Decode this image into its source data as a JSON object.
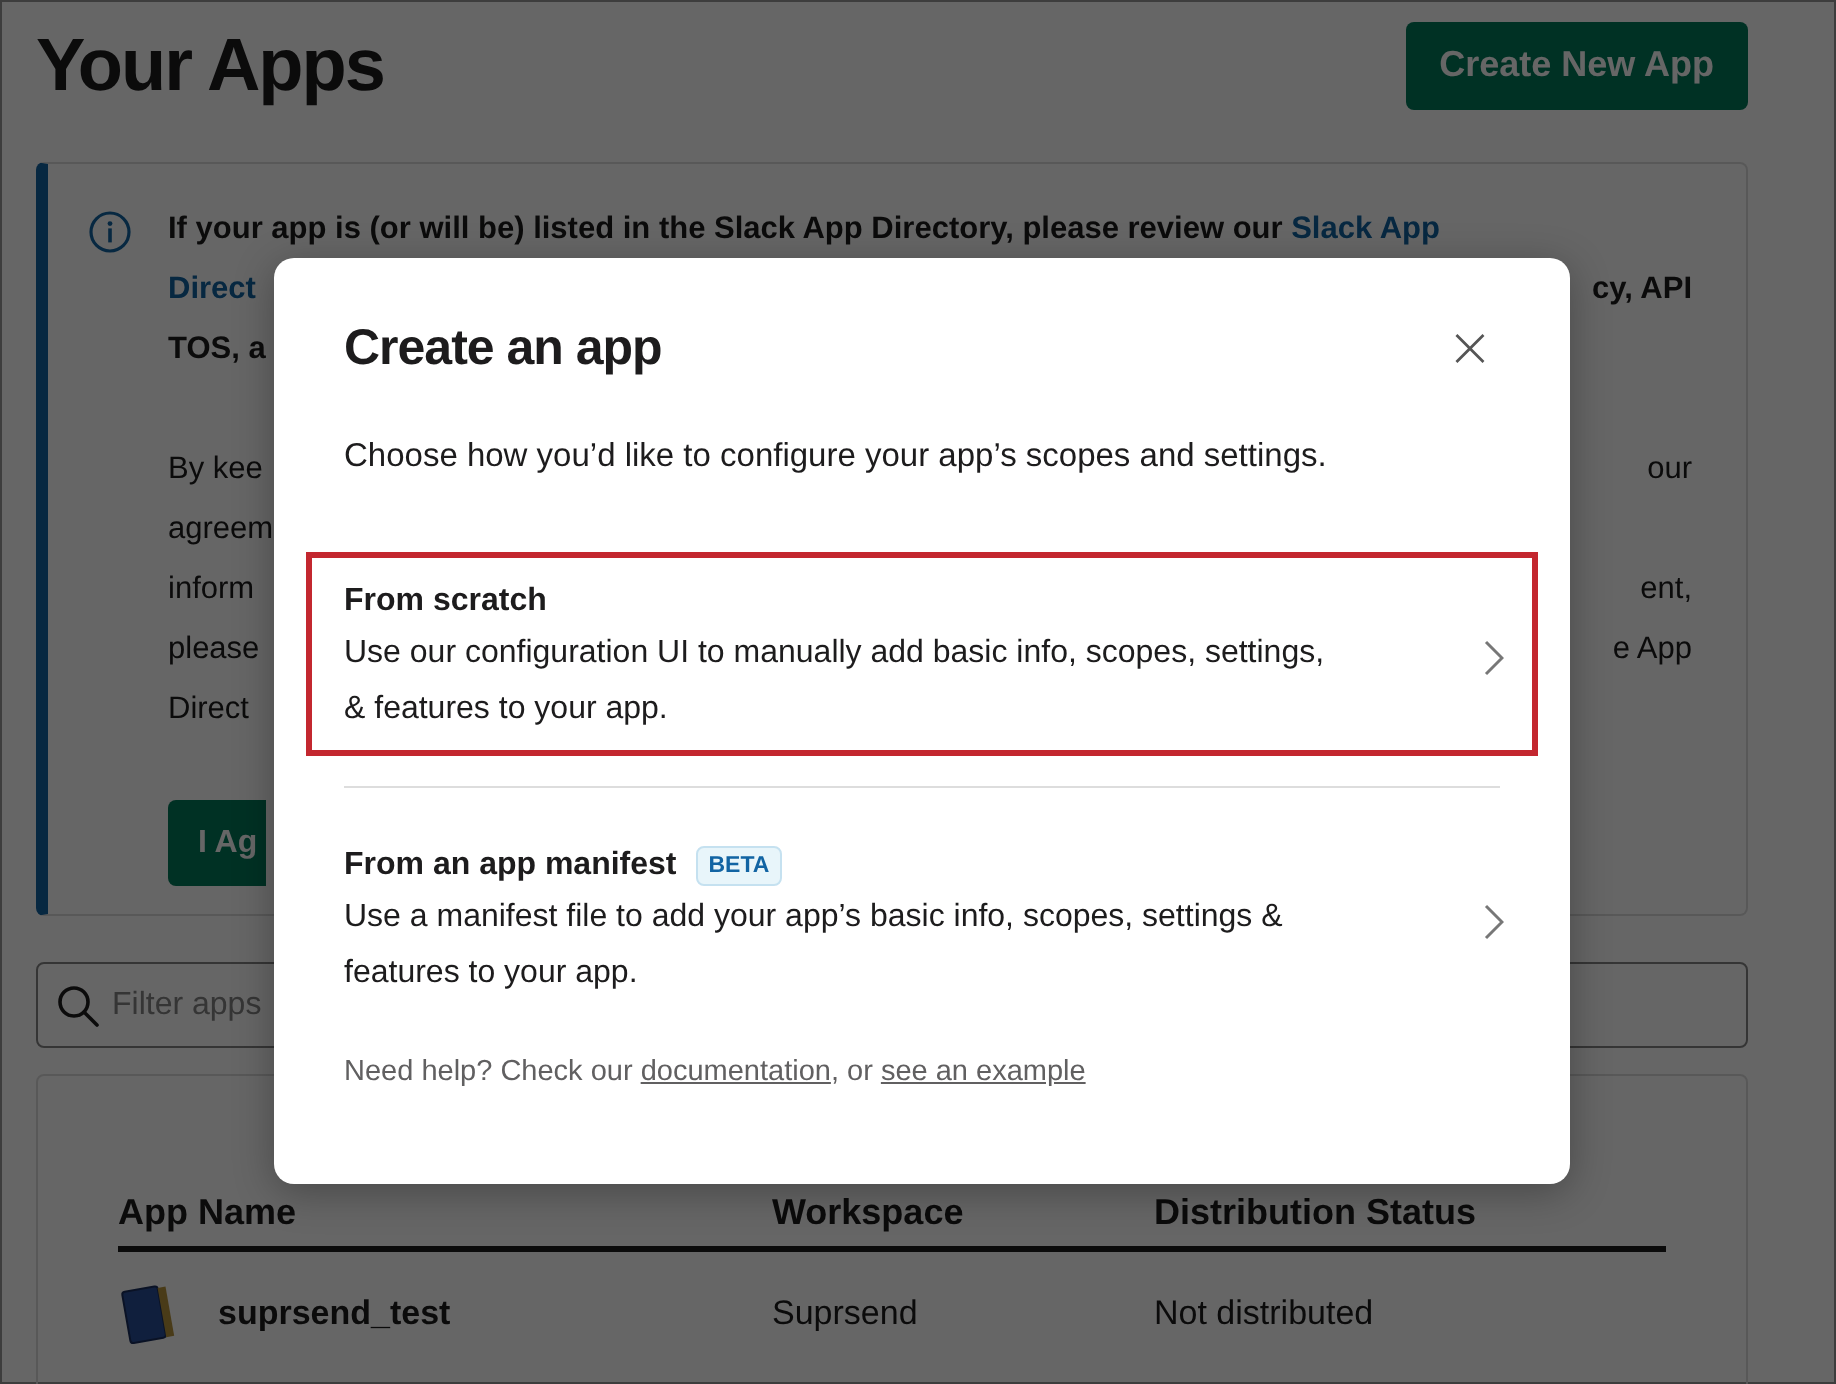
{
  "page": {
    "title": "Your Apps",
    "create_button": "Create New App",
    "banner": {
      "paragraphs": [
        {
          "lines": [
            {
              "left": [
                {
                  "text": "If your app is (or will be) listed in the Slack App Directory, please review our ",
                  "link": false
                },
                {
                  "text": "Slack App",
                  "link": true
                }
              ]
            },
            {
              "left": [
                {
                  "text": "Direct",
                  "link": true
                }
              ],
              "right": "cy, API"
            },
            {
              "left": [
                {
                  "text": "TOS, a",
                  "link": false
                }
              ]
            }
          ]
        },
        {
          "lines": [
            {
              "left": [
                {
                  "text": "By kee",
                  "link": false
                }
              ],
              "right": "our"
            },
            {
              "left": [
                {
                  "text": "agreem",
                  "link": false
                }
              ]
            },
            {
              "left": [
                {
                  "text": "inform",
                  "link": false
                }
              ],
              "right": "ent,"
            },
            {
              "left": [
                {
                  "text": "please",
                  "link": false
                }
              ],
              "right": "e App"
            },
            {
              "left": [
                {
                  "text": "Direct",
                  "link": false
                }
              ]
            }
          ]
        }
      ],
      "agree_button": "I Ag"
    },
    "filter": {
      "placeholder": "Filter apps"
    },
    "table": {
      "columns": [
        "App Name",
        "Workspace",
        "Distribution Status"
      ],
      "rows": [
        {
          "name": "suprsend_test",
          "workspace": "Suprsend",
          "status": "Not distributed"
        }
      ]
    }
  },
  "modal": {
    "title": "Create an app",
    "close": "×",
    "subtitle": "Choose how you’d like to configure your app’s scopes and settings.",
    "options": [
      {
        "title": "From scratch",
        "description": "Use our configuration UI to manually add basic info, scopes, settings, & features to your app.",
        "highlighted": true
      },
      {
        "title": "From an app manifest",
        "badge": "BETA",
        "description": "Use a manifest file to add your app’s basic info, scopes, settings & features to your app.",
        "highlighted": false
      }
    ],
    "help": [
      {
        "text": "Need help? Check our ",
        "link": false
      },
      {
        "text": "documentation",
        "link": true
      },
      {
        "text": ", or ",
        "link": false
      },
      {
        "text": "see an example",
        "link": true
      }
    ]
  }
}
